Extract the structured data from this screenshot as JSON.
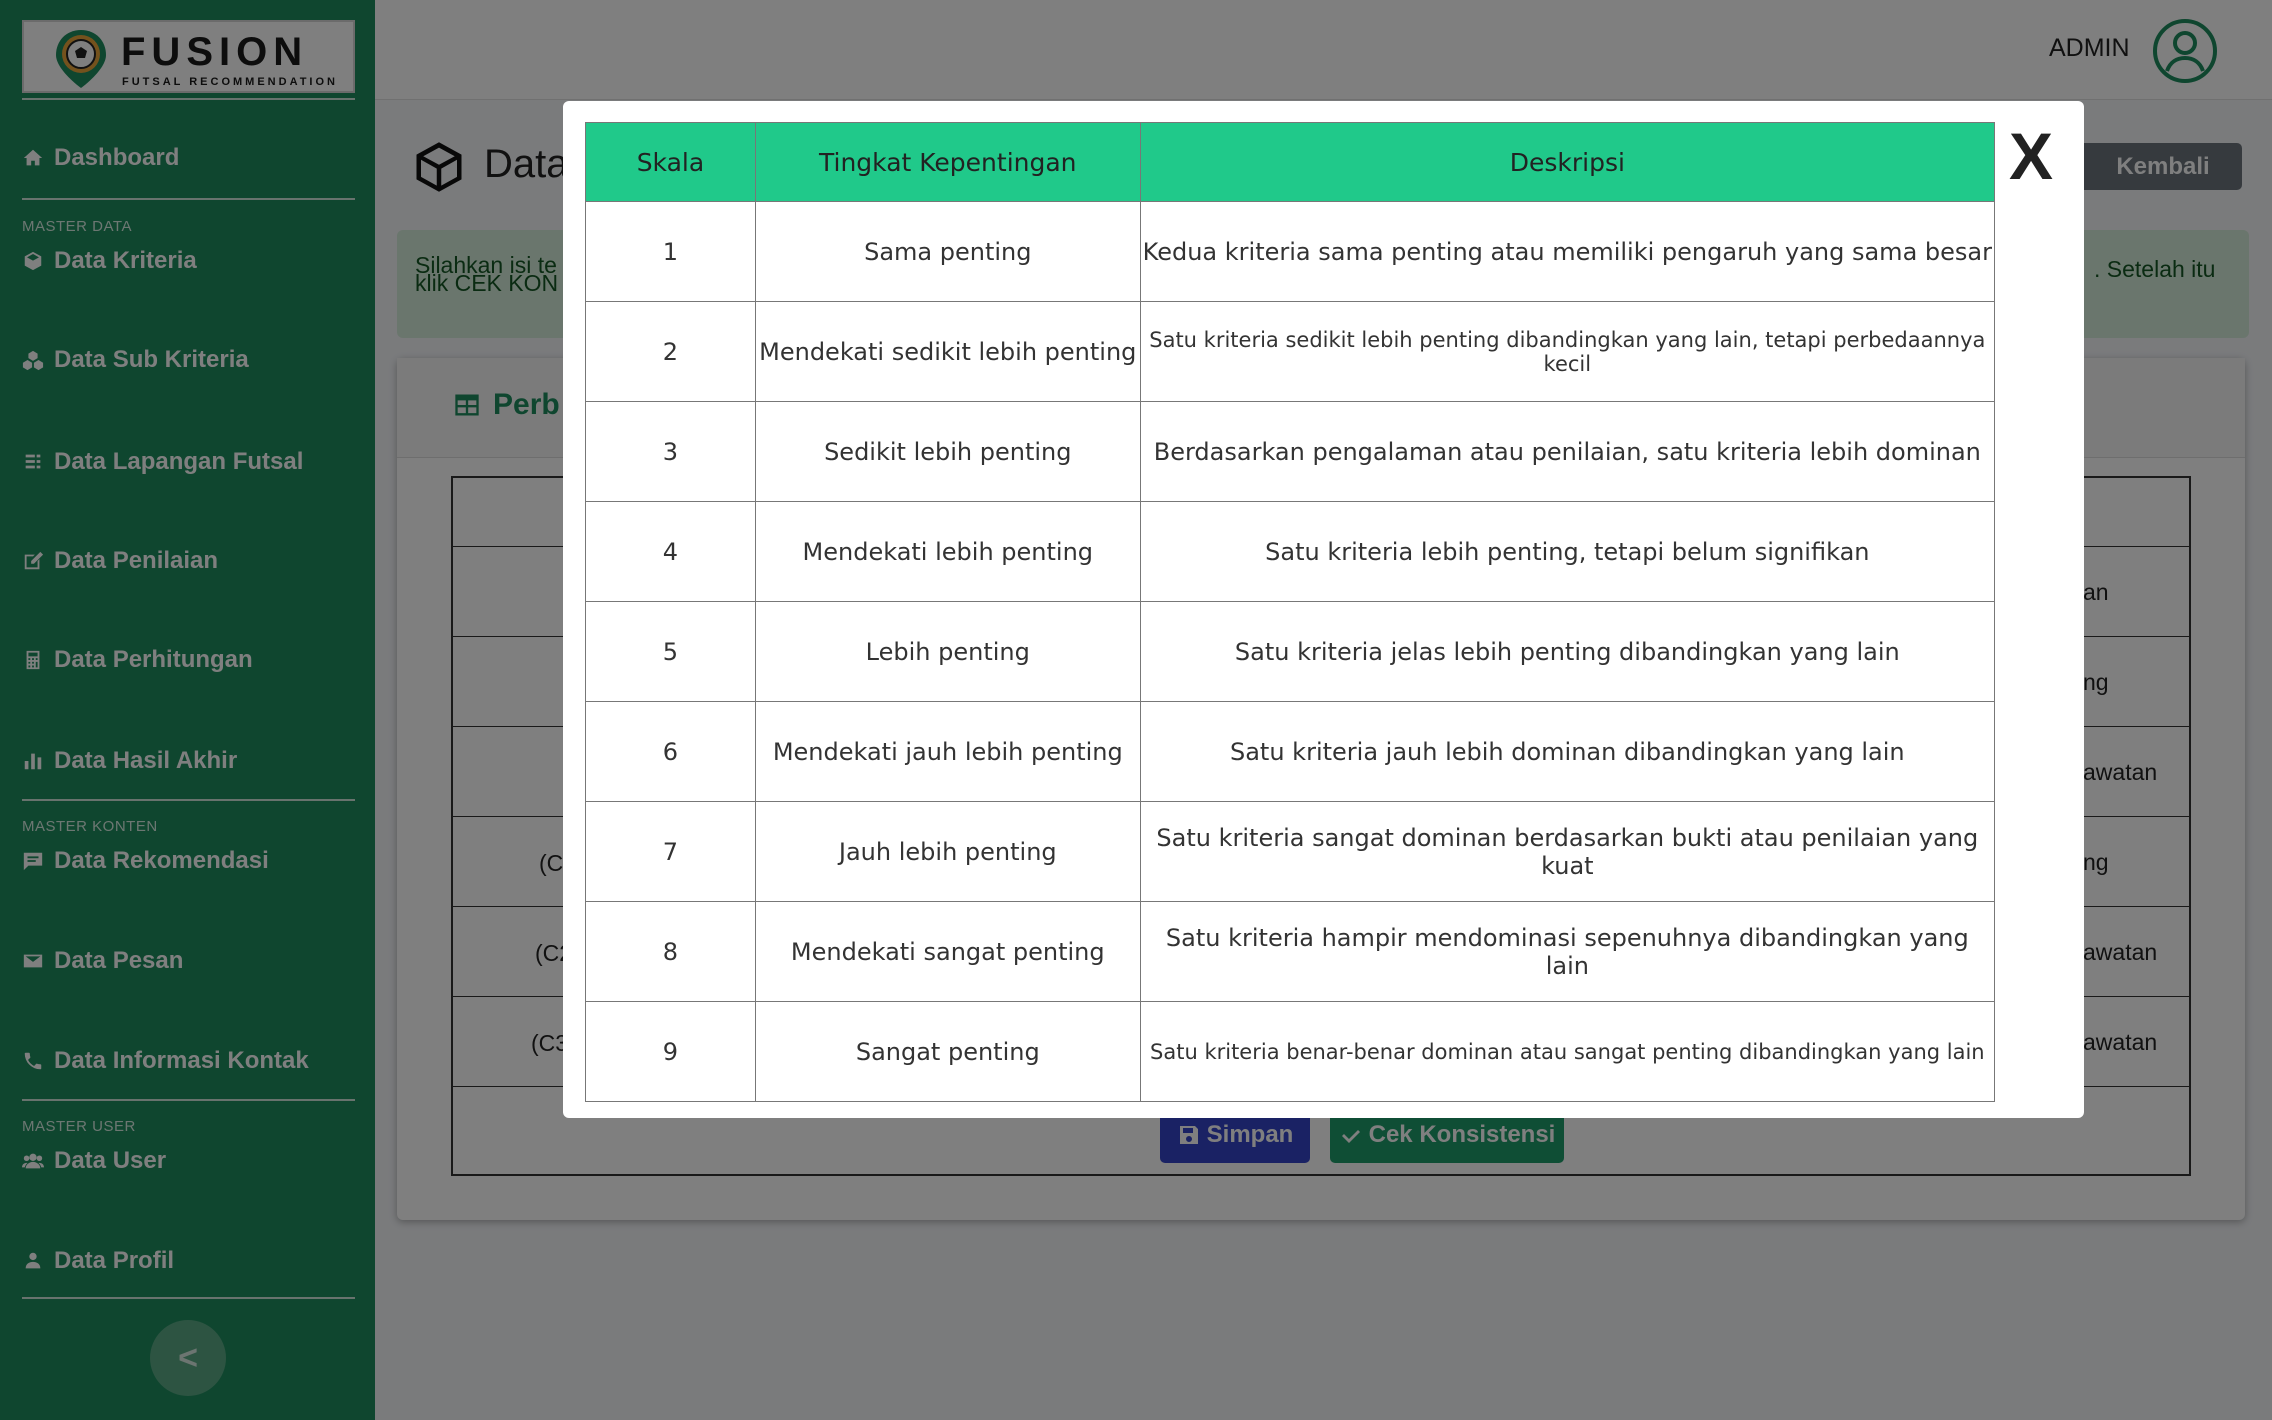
{
  "app": {
    "name": "FUSION",
    "subtitle": "FUTSAL RECOMMENDATION"
  },
  "sidebar": {
    "sections": [
      {
        "label": "MASTER DATA"
      },
      {
        "label": "MASTER KONTEN"
      },
      {
        "label": "MASTER USER"
      }
    ],
    "items": [
      {
        "label": "Dashboard",
        "icon": "home-icon"
      },
      {
        "label": "Data Kriteria",
        "icon": "cube-icon"
      },
      {
        "label": "Data Sub Kriteria",
        "icon": "cubes-icon"
      },
      {
        "label": "Data Lapangan Futsal",
        "icon": "list-icon"
      },
      {
        "label": "Data Penilaian",
        "icon": "edit-icon"
      },
      {
        "label": "Data Perhitungan",
        "icon": "calculator-icon"
      },
      {
        "label": "Data Hasil Akhir",
        "icon": "bar-chart-icon"
      },
      {
        "label": "Data Rekomendasi",
        "icon": "comment-icon"
      },
      {
        "label": "Data Pesan",
        "icon": "envelope-icon"
      },
      {
        "label": "Data Informasi Kontak",
        "icon": "phone-icon"
      },
      {
        "label": "Data User",
        "icon": "users-icon"
      },
      {
        "label": "Data Profil",
        "icon": "user-icon"
      }
    ],
    "toggle_label": "<"
  },
  "header": {
    "user_name": "ADMIN"
  },
  "page": {
    "title": "Data",
    "back_label": "Kembali",
    "alert_left_line1": "Silahkan isi te",
    "alert_left_line2": "klik CEK KON",
    "alert_right": ". Setelah itu",
    "card_title": "Perb",
    "save_label": "Simpan",
    "check_label": "Cek Konsistensi",
    "bg_cells_left": [
      "(C",
      "(C2",
      "(C3"
    ],
    "bg_cells_right": [
      "an",
      "ng",
      "awatan",
      "ng",
      "awatan",
      "awatan"
    ]
  },
  "modal": {
    "close_label": "X",
    "headers": [
      "Skala",
      "Tingkat Kepentingan",
      "Deskripsi"
    ],
    "rows": [
      {
        "scale": "1",
        "level": "Sama penting",
        "description": "Kedua kriteria sama penting atau memiliki pengaruh yang sama besar"
      },
      {
        "scale": "2",
        "level": "Mendekati sedikit lebih penting",
        "description": "Satu kriteria sedikit lebih penting dibandingkan yang lain, tetapi perbedaannya kecil"
      },
      {
        "scale": "3",
        "level": "Sedikit lebih penting",
        "description": "Berdasarkan pengalaman atau penilaian, satu kriteria lebih dominan"
      },
      {
        "scale": "4",
        "level": "Mendekati lebih penting",
        "description": "Satu kriteria lebih penting, tetapi belum signifikan"
      },
      {
        "scale": "5",
        "level": "Lebih penting",
        "description": "Satu kriteria jelas lebih penting dibandingkan yang lain"
      },
      {
        "scale": "6",
        "level": "Mendekati jauh lebih penting",
        "description": "Satu kriteria jauh lebih dominan dibandingkan yang lain"
      },
      {
        "scale": "7",
        "level": "Jauh lebih penting",
        "description": "Satu kriteria sangat dominan berdasarkan bukti atau penilaian yang kuat"
      },
      {
        "scale": "8",
        "level": "Mendekati sangat penting",
        "description": "Satu kriteria hampir mendominasi sepenuhnya dibandingkan yang lain"
      },
      {
        "scale": "9",
        "level": "Sangat penting",
        "description": "Satu kriteria benar-benar dominan atau sangat penting dibandingkan yang lain"
      }
    ]
  },
  "colors": {
    "sidebar": "#1e8c5f",
    "accent": "#20c98a",
    "primary": "#3545c8"
  }
}
